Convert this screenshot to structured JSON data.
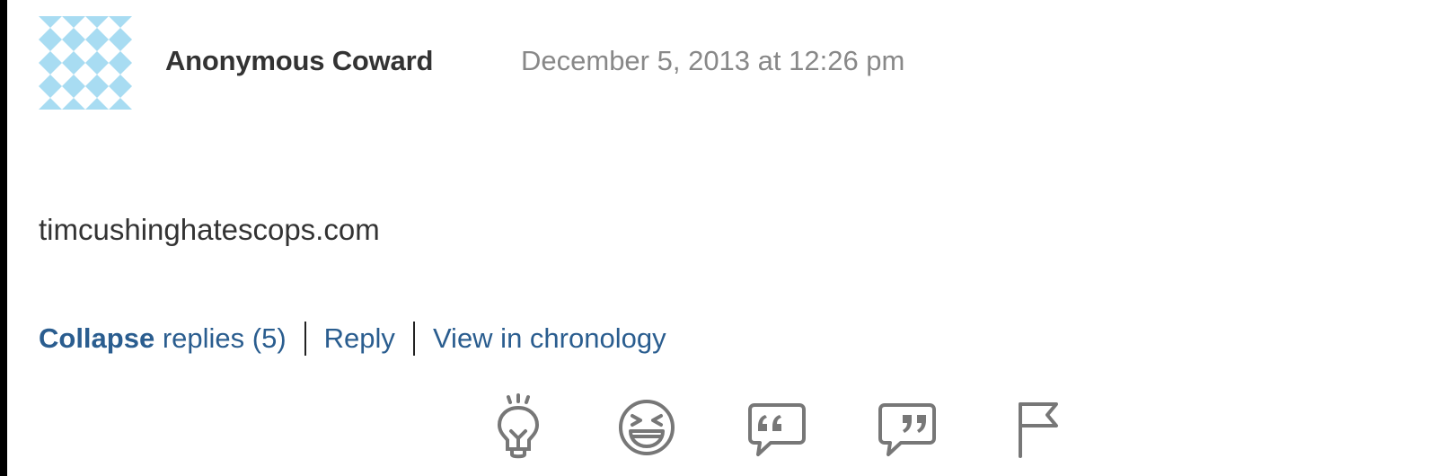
{
  "comment": {
    "author": "Anonymous Coward",
    "timestamp": "December 5, 2013 at 12:26 pm",
    "body": "timcushinghatescops.com"
  },
  "links": {
    "collapse_label": "Collapse",
    "replies_label": "replies (5)",
    "reply_label": "Reply",
    "chronology_label": "View in chronology"
  },
  "colors": {
    "link": "#2a5d8f",
    "meta": "#888888",
    "text": "#333333",
    "icon": "#777777",
    "avatar": "#a8dcf2"
  },
  "actions": [
    {
      "icon": "lightbulb-icon"
    },
    {
      "icon": "laughing-face-icon"
    },
    {
      "icon": "quote-open-icon"
    },
    {
      "icon": "quote-close-icon"
    },
    {
      "icon": "flag-icon"
    }
  ]
}
